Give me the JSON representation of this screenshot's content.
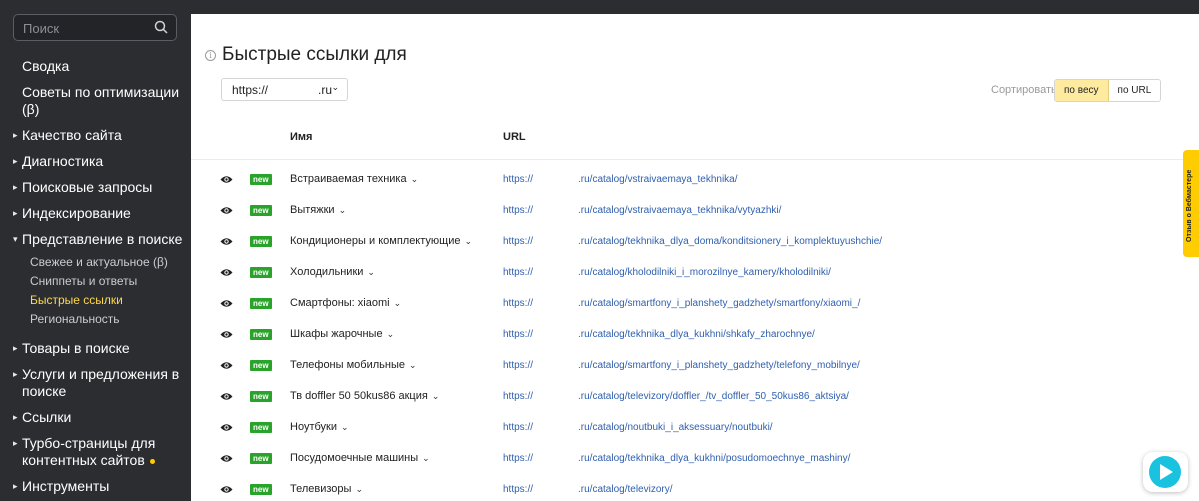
{
  "search": {
    "placeholder": "Поиск"
  },
  "sidebar": {
    "items": [
      {
        "label": "Сводка",
        "caret": ""
      },
      {
        "label": "Советы по оптимизации (β)",
        "caret": ""
      },
      {
        "label": "Качество сайта",
        "caret": "▸"
      },
      {
        "label": "Диагностика",
        "caret": "▸"
      },
      {
        "label": "Поисковые запросы",
        "caret": "▸"
      },
      {
        "label": "Индексирование",
        "caret": "▸"
      },
      {
        "label": "Представление в поиске",
        "caret": "▾"
      }
    ],
    "subitems": [
      {
        "label": "Свежее и актуальное (β)"
      },
      {
        "label": "Сниппеты и ответы"
      },
      {
        "label": "Быстрые ссылки",
        "active": true
      },
      {
        "label": "Региональность"
      }
    ],
    "items2": [
      {
        "label": "Товары в поиске",
        "caret": "▸"
      },
      {
        "label": "Услуги и предложения в поиске",
        "caret": "▸"
      },
      {
        "label": "Ссылки",
        "caret": "▸"
      },
      {
        "label": "Турбо-страницы для контентных сайтов",
        "caret": "▸"
      },
      {
        "label": "Инструменты",
        "caret": "▸"
      }
    ]
  },
  "header": {
    "title": "Быстрые ссылки для",
    "host_proto": "https://",
    "host_tld": ".ru",
    "sort_label": "Сортировать",
    "sort_by_weight": "по весу",
    "sort_by_url": "по URL"
  },
  "table": {
    "col_name": "Имя",
    "col_url": "URL",
    "badge": "new",
    "proto": "https://",
    "rows": [
      {
        "name": "Встраиваемая техника",
        "path": ".ru/catalog/vstraivaemaya_tekhnika/"
      },
      {
        "name": "Вытяжки",
        "path": ".ru/catalog/vstraivaemaya_tekhnika/vytyazhki/"
      },
      {
        "name": "Кондиционеры и комплектующие",
        "path": ".ru/catalog/tekhnika_dlya_doma/konditsionery_i_komplektuyushchie/"
      },
      {
        "name": "Холодильники",
        "path": ".ru/catalog/kholodilniki_i_morozilnye_kamery/kholodilniki/"
      },
      {
        "name": "Смартфоны: xiaomi",
        "path": ".ru/catalog/smartfony_i_planshety_gadzhety/smartfony/xiaomi_/"
      },
      {
        "name": "Шкафы жарочные",
        "path": ".ru/catalog/tekhnika_dlya_kukhni/shkafy_zharochnye/"
      },
      {
        "name": "Телефоны мобильные",
        "path": ".ru/catalog/smartfony_i_planshety_gadzhety/telefony_mobilnye/"
      },
      {
        "name": "Тв doffler 50 50kus86 акция",
        "path": ".ru/catalog/televizory/doffler_/tv_doffler_50_50kus86_aktsiya/"
      },
      {
        "name": "Ноутбуки",
        "path": ".ru/catalog/noutbuki_i_aksessuary/noutbuki/"
      },
      {
        "name": "Посудомоечные машины",
        "path": ".ru/catalog/tekhnika_dlya_kukhni/posudomoechnye_mashiny/"
      },
      {
        "name": "Телевизоры",
        "path": ".ru/catalog/televizory/"
      }
    ]
  },
  "feedback": {
    "label": "Отзыв о Вебмастере"
  },
  "icons": {
    "search": "search-icon",
    "eye": "eye-icon",
    "info": "info-icon",
    "chat": "chat-icon"
  },
  "colors": {
    "accent": "#ffcc00",
    "badge": "#29a329",
    "link": "#2f5fae",
    "sidebar": "#2b2d31"
  }
}
